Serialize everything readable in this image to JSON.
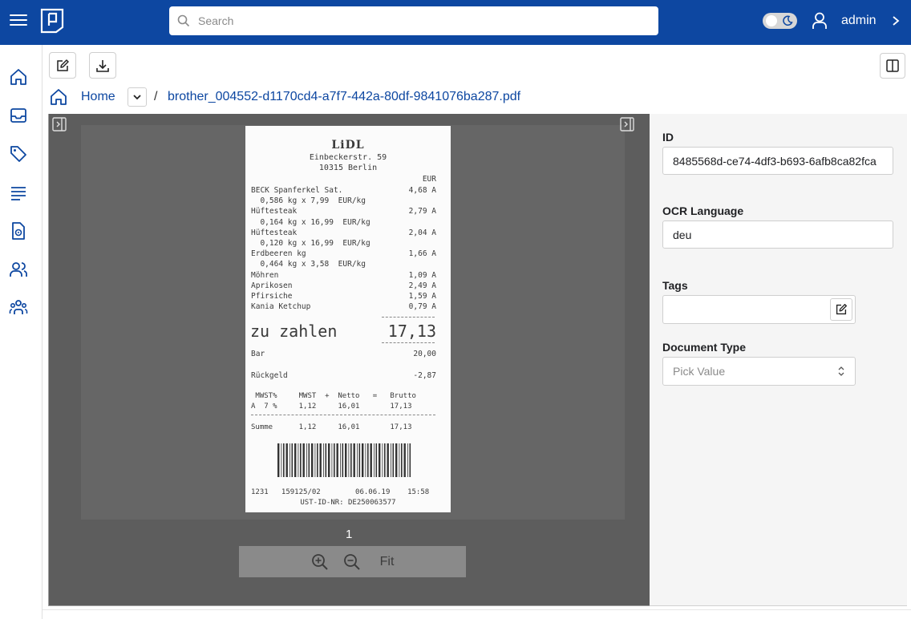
{
  "header": {
    "search_placeholder": "Search",
    "username": "admin"
  },
  "sidebar": {
    "items": [
      "home-icon",
      "inbox-icon",
      "tag-icon",
      "lines-icon",
      "document-icon",
      "users-icon",
      "groups-icon"
    ]
  },
  "breadcrumb": {
    "home": "Home",
    "separator": "/",
    "file": "brother_004552-d1170cd4-a7f7-442a-80df-9841076ba287.pdf"
  },
  "viewer": {
    "page_number": "1",
    "fit_label": "Fit",
    "receipt": {
      "brand": "LiDL",
      "address1": "Einbeckerstr. 59",
      "address2": "10315 Berlin",
      "currency": "EUR",
      "items": [
        {
          "left": "BECK Spanferkel Sat.",
          "right": "4,68 A"
        },
        {
          "left": "  0,586 kg x 7,99  EUR/kg",
          "right": ""
        },
        {
          "left": "Hüftesteak",
          "right": "2,79 A"
        },
        {
          "left": "  0,164 kg x 16,99  EUR/kg",
          "right": ""
        },
        {
          "left": "Hüftesteak",
          "right": "2,04 A"
        },
        {
          "left": "  0,120 kg x 16,99  EUR/kg",
          "right": ""
        },
        {
          "left": "Erdbeeren kg",
          "right": "1,66 A"
        },
        {
          "left": "  0,464 kg x 3,58  EUR/kg",
          "right": ""
        },
        {
          "left": "Möhren",
          "right": "1,09 A"
        },
        {
          "left": "Aprikosen",
          "right": "2,49 A"
        },
        {
          "left": "Pfirsiche",
          "right": "1,59 A"
        },
        {
          "left": "Kania Ketchup",
          "right": "0,79 A"
        }
      ],
      "total_label": "zu zahlen",
      "total_value": "17,13",
      "bar_label": "Bar",
      "bar_value": "20,00",
      "change_label": "Rückgeld",
      "change_value": "-2,87",
      "vat_header": " MWST%     MWST  +  Netto   =   Brutto",
      "vat_row": "A  7 %     1,12     16,01       17,13",
      "sum_row": "Summe      1,12     16,01       17,13",
      "footer1": "1231   159125/02        06.06.19    15:58",
      "footer2": "UST-ID-NR: DE250063577"
    }
  },
  "details": {
    "id_label": "ID",
    "id_value": "8485568d-ce74-4df3-b693-6afb8ca82fca",
    "ocr_label": "OCR Language",
    "ocr_value": "deu",
    "tags_label": "Tags",
    "doctype_label": "Document Type",
    "doctype_placeholder": "Pick Value"
  },
  "colors": {
    "header_bg": "#0d47a1",
    "accent": "#0d47a1",
    "viewer_bg": "#5d5d5d",
    "panel_bg": "#f5f5f5"
  }
}
